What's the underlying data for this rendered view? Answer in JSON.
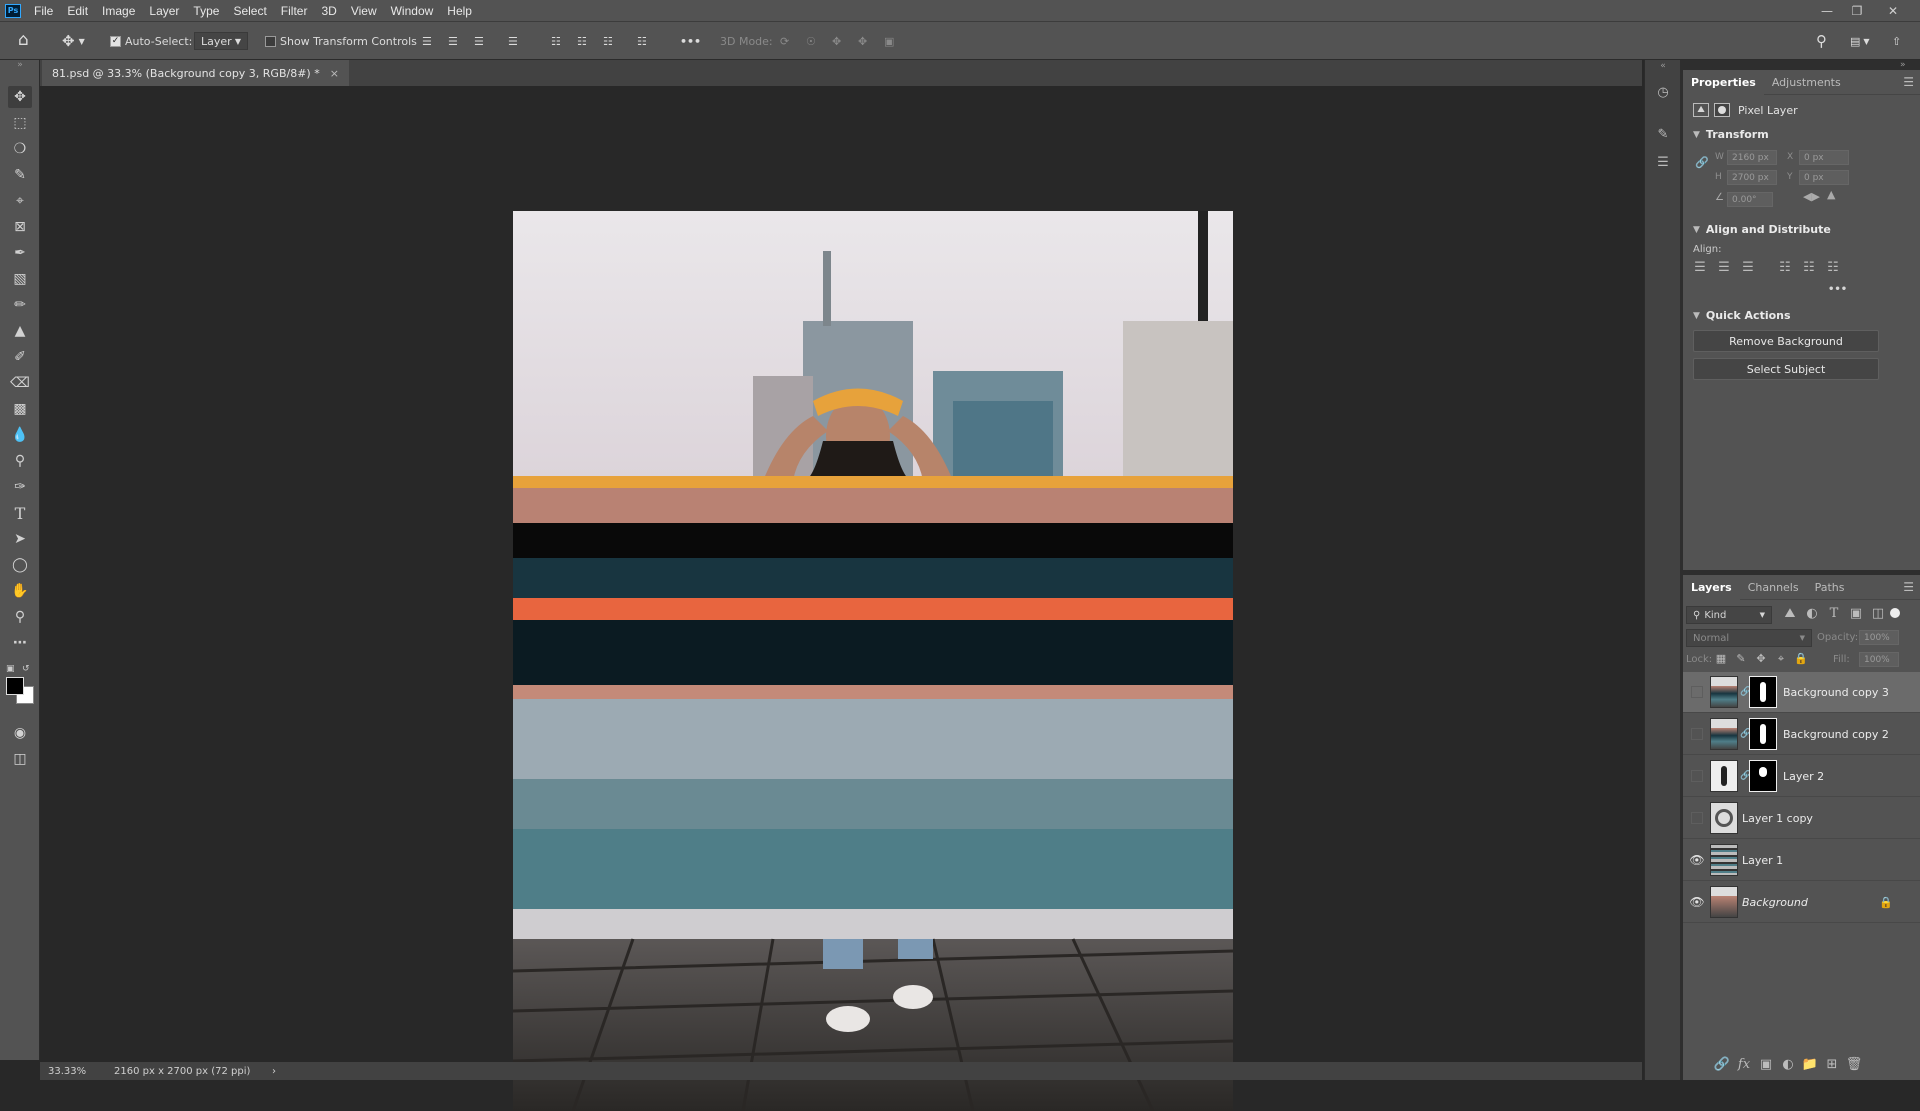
{
  "menubar": {
    "logo": "Ps",
    "items": [
      "File",
      "Edit",
      "Image",
      "Layer",
      "Type",
      "Select",
      "Filter",
      "3D",
      "View",
      "Window",
      "Help"
    ]
  },
  "options": {
    "auto_select_label": "Auto-Select:",
    "auto_select_checked": true,
    "auto_select_target": "Layer",
    "show_transform_label": "Show Transform Controls",
    "mode_3d_label": "3D Mode:",
    "more": "•••"
  },
  "document": {
    "tab_title": "81.psd @ 33.3% (Background copy 3, RGB/8#) *",
    "tab_close": "×"
  },
  "status": {
    "zoom": "33.33%",
    "doc_size": "2160 px x 2700 px (72 ppi)",
    "arrow": "›"
  },
  "properties": {
    "tabs": [
      "Properties",
      "Adjustments"
    ],
    "kind_label": "Pixel Layer",
    "transform": {
      "title": "Transform",
      "w_label": "W",
      "w_value": "2160 px",
      "h_label": "H",
      "h_value": "2700 px",
      "x_label": "X",
      "x_value": "0 px",
      "y_label": "Y",
      "y_value": "0 px",
      "angle_value": "0.00°"
    },
    "align": {
      "title": "Align and Distribute",
      "align_label": "Align:",
      "more": "•••"
    },
    "quick_actions": {
      "title": "Quick Actions",
      "remove_bg": "Remove Background",
      "select_subject": "Select Subject"
    }
  },
  "layers_panel": {
    "tabs": [
      "Layers",
      "Channels",
      "Paths"
    ],
    "filter_kind": "Kind",
    "blend_mode": "Normal",
    "opacity_label": "Opacity:",
    "opacity_value": "100%",
    "lock_label": "Lock:",
    "fill_label": "Fill:",
    "fill_value": "100%",
    "layers": [
      {
        "name": "Background copy 3",
        "visible": false,
        "selected": true,
        "has_mask": true
      },
      {
        "name": "Background copy 2",
        "visible": false,
        "selected": false,
        "has_mask": true
      },
      {
        "name": "Layer 2",
        "visible": false,
        "selected": false,
        "has_mask": true
      },
      {
        "name": "Layer 1 copy",
        "visible": false,
        "selected": false,
        "has_mask": false
      },
      {
        "name": "Layer 1",
        "visible": true,
        "selected": false,
        "has_mask": false
      },
      {
        "name": "Background",
        "visible": true,
        "selected": false,
        "has_mask": false,
        "locked": true
      }
    ]
  },
  "colors": {
    "ui_bg": "#535353",
    "dark_bg": "#282828",
    "accent_orange": "#e8653f",
    "band_teal": "#4f7e88"
  }
}
